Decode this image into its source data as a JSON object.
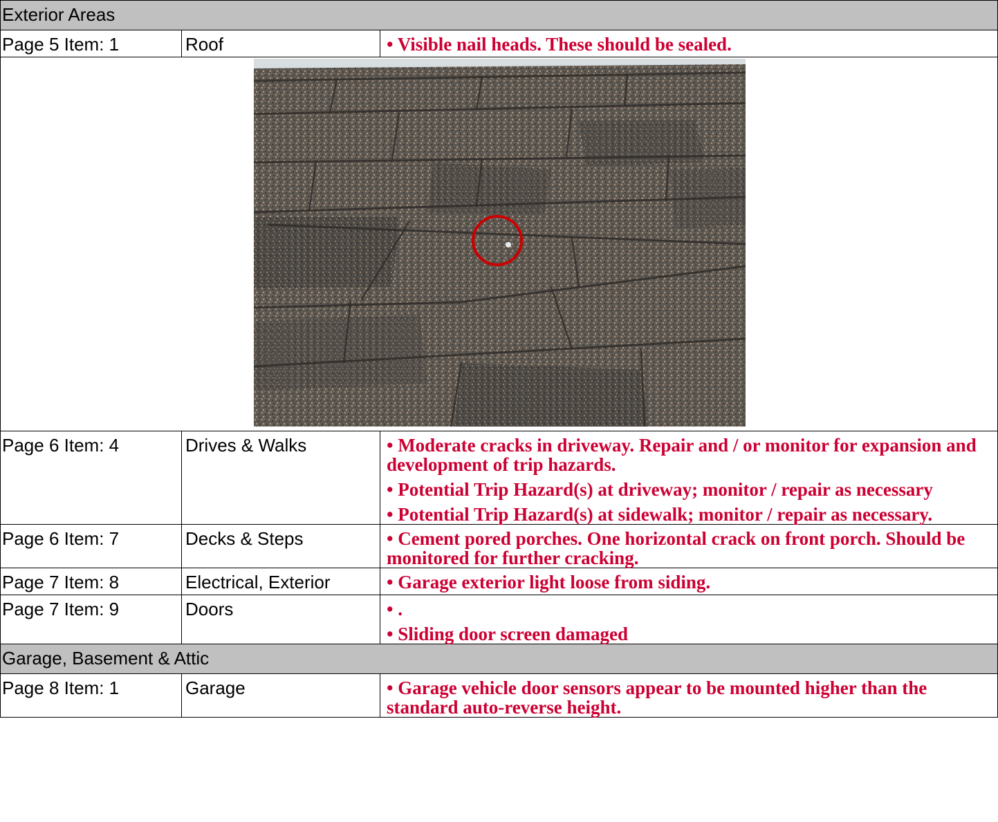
{
  "sections": [
    {
      "title": "Exterior Areas",
      "rows": [
        {
          "page": "Page 5 Item: 1",
          "category": "Roof",
          "notes": [
            "• Visible nail heads.  These should be sealed."
          ]
        },
        {
          "page": "Page 6 Item: 4",
          "category": "Drives & Walks",
          "notes": [
            "• Moderate cracks in driveway.   Repair and / or monitor for expansion and development of trip hazards.",
            "• Potential Trip Hazard(s) at driveway; monitor / repair as necessary",
            "• Potential Trip Hazard(s) at sidewalk; monitor / repair as necessary."
          ]
        },
        {
          "page": "Page 6 Item: 7",
          "category": "Decks & Steps",
          "notes": [
            "• Cement pored porches.  One horizontal crack on front porch.  Should be monitored for further cracking."
          ]
        },
        {
          "page": "Page 7 Item: 8",
          "category": "Electrical, Exterior",
          "notes": [
            "• Garage exterior light loose from siding."
          ]
        },
        {
          "page": "Page 7 Item: 9",
          "category": "Doors",
          "notes": [
            "• .",
            "• Sliding door screen damaged"
          ]
        }
      ]
    },
    {
      "title": "Garage, Basement & Attic",
      "rows": [
        {
          "page": "Page 8 Item: 1",
          "category": "Garage",
          "notes": [
            "• Garage vehicle door sensors appear to be mounted higher than the standard auto-reverse height."
          ]
        }
      ]
    }
  ],
  "photo": {
    "subject": "roof-shingles-photo",
    "marker_color": "#cc0000"
  },
  "colors": {
    "note_text": "#cc0033",
    "section_bg": "#c0c0c0"
  }
}
